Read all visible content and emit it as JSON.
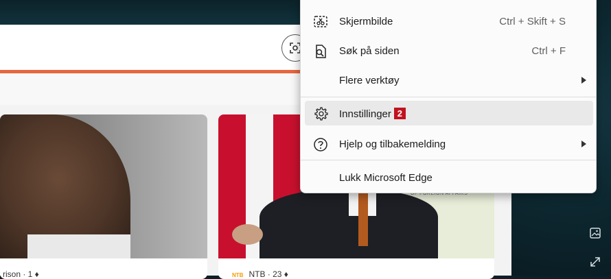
{
  "menu": {
    "items": [
      {
        "label": "Skjermbilde",
        "shortcut": "Ctrl + Skift + S",
        "icon": "screenshot-icon"
      },
      {
        "label": "Søk på siden",
        "shortcut": "Ctrl + F",
        "icon": "find-on-page-icon"
      },
      {
        "label": "Flere verktøy",
        "icon": "none",
        "submenu": true
      },
      {
        "label": "Innstillinger",
        "icon": "gear-icon",
        "badge": "2",
        "highlighted": true
      },
      {
        "label": "Hjelp og tilbakemelding",
        "icon": "help-icon",
        "submenu": true
      },
      {
        "label": "Lukk Microsoft Edge",
        "icon": "none"
      }
    ]
  },
  "feed": {
    "card1_meta": "rison · 1 ♦",
    "card2_source_logo": "NTB",
    "card2_meta": "NTB · 23 ♦",
    "poster_text": "OF FOREIGN AFFAIRS"
  },
  "colors": {
    "accent_bar": "#e8663d",
    "badge": "#c1121f",
    "menu_bg": "#fbfbfb",
    "highlight": "#e9e9e9"
  }
}
